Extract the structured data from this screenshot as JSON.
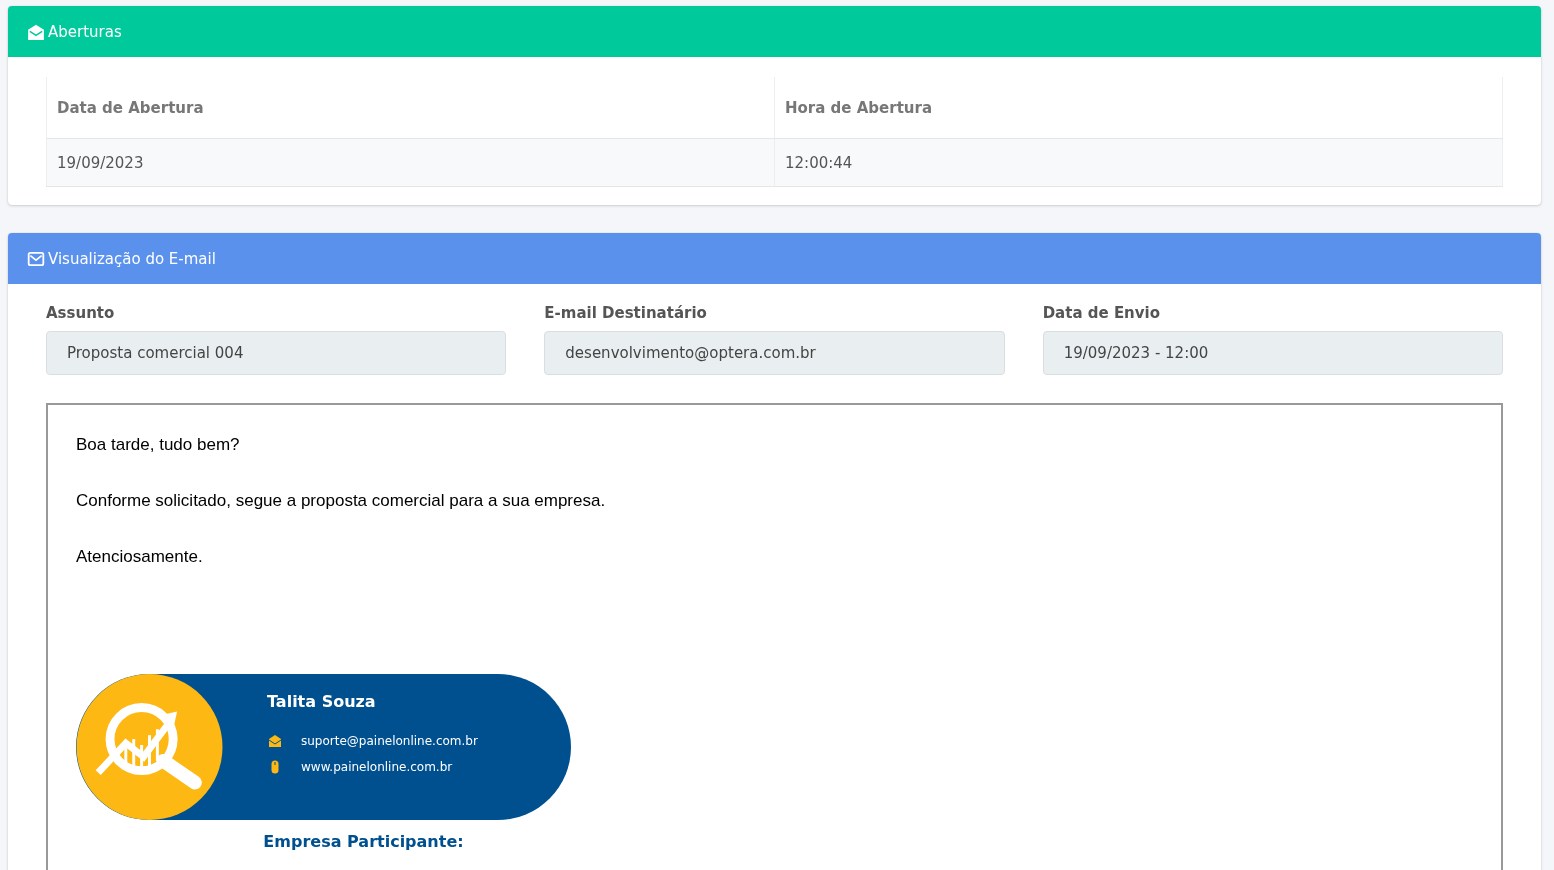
{
  "openings_card": {
    "title": "Aberturas",
    "table": {
      "columns": [
        "Data de Abertura",
        "Hora de Abertura"
      ],
      "rows": [
        [
          "19/09/2023",
          "12:00:44"
        ]
      ]
    }
  },
  "email_card": {
    "title": "Visualização do E-mail",
    "fields": [
      {
        "label": "Assunto",
        "value": "Proposta comercial 004"
      },
      {
        "label": "E-mail Destinatário",
        "value": "desenvolvimento@optera.com.br"
      },
      {
        "label": "Data de Envio",
        "value": "19/09/2023 - 12:00"
      }
    ],
    "body": {
      "paragraphs": [
        "Boa tarde, tudo bem?",
        "Conforme solicitado, segue a proposta comercial para a sua empresa.",
        "Atenciosamente."
      ],
      "signature": {
        "name": "Talita Souza",
        "email": "suporte@painelonline.com.br",
        "website": "www.painelonline.com.br",
        "footer": "Empresa Participante:"
      }
    }
  }
}
